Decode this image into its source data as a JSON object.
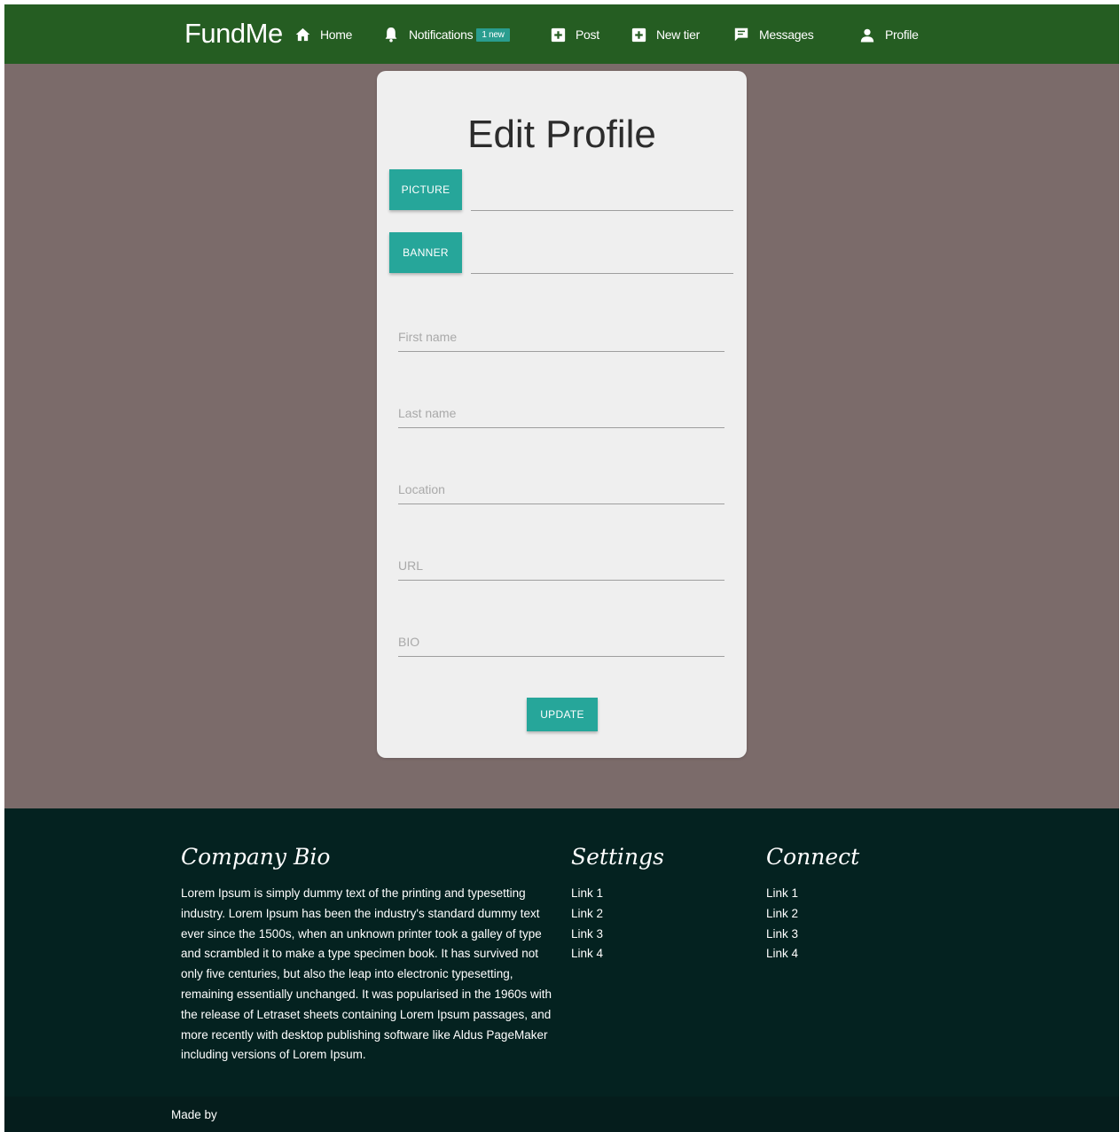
{
  "nav": {
    "brand": "FundMe",
    "items": [
      {
        "label": "Home",
        "icon": "home-icon"
      },
      {
        "label": "Notifications",
        "icon": "bell-icon",
        "badge": "1 new"
      },
      {
        "label": "Post",
        "icon": "plus-box-icon"
      },
      {
        "label": "New tier",
        "icon": "plus-box-icon"
      },
      {
        "label": "Messages",
        "icon": "chat-icon"
      },
      {
        "label": "Profile",
        "icon": "person-icon"
      }
    ]
  },
  "form": {
    "title": "Edit Profile",
    "picture_button": "PICTURE",
    "banner_button": "BANNER",
    "fields": [
      {
        "placeholder": "First name"
      },
      {
        "placeholder": "Last name"
      },
      {
        "placeholder": "Location"
      },
      {
        "placeholder": "URL"
      },
      {
        "placeholder": "BIO"
      }
    ],
    "update_button": "UPDATE"
  },
  "footer": {
    "bio_title": "Company Bio",
    "bio_text": "Lorem Ipsum is simply dummy text of the printing and typesetting industry. Lorem Ipsum has been the industry's standard dummy text ever since the 1500s, when an unknown printer took a galley of type and scrambled it to make a type specimen book. It has survived not only five centuries, but also the leap into electronic typesetting, remaining essentially unchanged. It was popularised in the 1960s with the release of Letraset sheets containing Lorem Ipsum passages, and more recently with desktop publishing software like Aldus PageMaker including versions of Lorem Ipsum.",
    "settings_title": "Settings",
    "settings_links": [
      "Link 1",
      "Link 2",
      "Link 3",
      "Link 4"
    ],
    "connect_title": "Connect",
    "connect_links": [
      "Link 1",
      "Link 2",
      "Link 3",
      "Link 4"
    ],
    "made_by": "Made by"
  },
  "colors": {
    "nav_bg": "#255d22",
    "page_bg": "#7b6b6a",
    "card_bg": "#efefef",
    "accent": "#26a69a",
    "footer_bg": "#042220"
  }
}
